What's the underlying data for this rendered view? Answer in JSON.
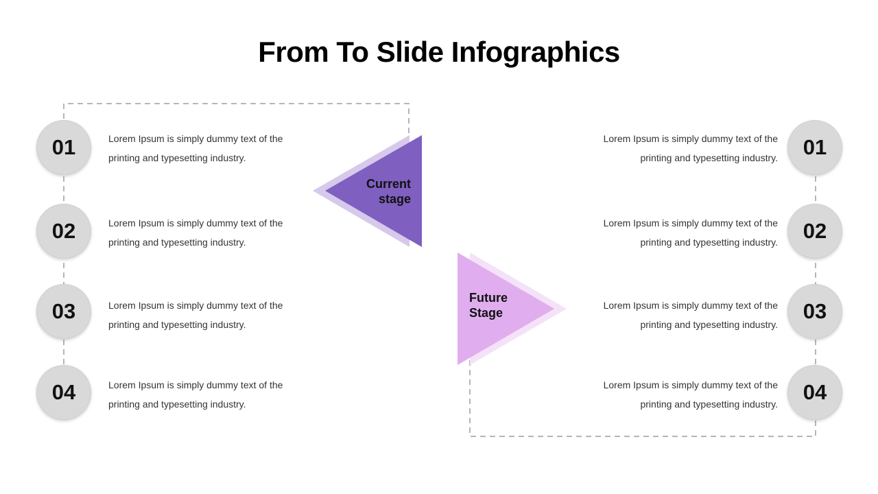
{
  "title": "From To Slide Infographics",
  "colors": {
    "current_main": "#7f5fbf",
    "current_shadow": "#d6c9eb",
    "future_main": "#e0aeee",
    "future_shadow": "#f4e2f8",
    "circle_fill": "#d9d9d9",
    "dash": "#b5b5b5"
  },
  "current_stage": {
    "label_line1": "Current",
    "label_line2": "stage"
  },
  "future_stage": {
    "label_line1": "Future",
    "label_line2": "Stage"
  },
  "left_items": [
    {
      "number": "01",
      "line1": "Lorem Ipsum is simply dummy text of the",
      "line2": "printing and typesetting industry."
    },
    {
      "number": "02",
      "line1": "Lorem Ipsum is simply dummy text of the",
      "line2": "printing and typesetting industry."
    },
    {
      "number": "03",
      "line1": "Lorem Ipsum is simply dummy text of the",
      "line2": "printing and typesetting industry."
    },
    {
      "number": "04",
      "line1": "Lorem Ipsum is simply dummy text of the",
      "line2": "printing and typesetting industry."
    }
  ],
  "right_items": [
    {
      "number": "01",
      "line1": "Lorem Ipsum is simply dummy text of the",
      "line2": "printing and typesetting industry."
    },
    {
      "number": "02",
      "line1": "Lorem Ipsum is simply dummy text of the",
      "line2": "printing and typesetting industry."
    },
    {
      "number": "03",
      "line1": "Lorem Ipsum is simply dummy text of the",
      "line2": "printing and typesetting industry."
    },
    {
      "number": "04",
      "line1": "Lorem Ipsum is simply dummy text of the",
      "line2": "printing and typesetting industry."
    }
  ]
}
